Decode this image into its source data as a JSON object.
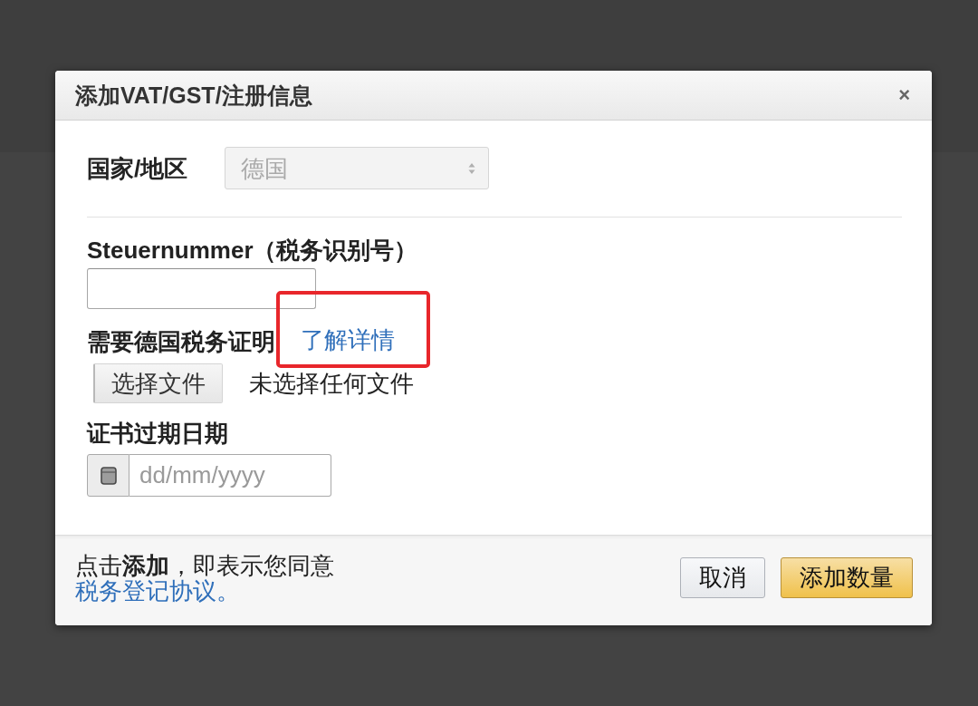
{
  "dialog": {
    "title": "添加VAT/GST/注册信息",
    "close_button": "×",
    "country": {
      "label": "国家/地区",
      "value": "德国",
      "disabled": true
    },
    "tax_number": {
      "label": "Steuernummer（税务识别号）"
    },
    "certificate": {
      "label": "需要德国税务证明",
      "link": {
        "label": "了解详情",
        "highlighted": true
      },
      "file_button": "选择文件",
      "file_status": "未选择任何文件"
    },
    "expiry_date": {
      "label": "证书过期日期",
      "placeholder": "dd/mm/yyyy"
    },
    "footer": {
      "agreement_text": "点击**添加**，即表示您同意",
      "agreement_link": "税务登记协议。",
      "buttons": [
        {
          "label": "取消",
          "kind": "secondary"
        },
        {
          "label": "添加数量",
          "kind": "primary"
        }
      ]
    }
  }
}
